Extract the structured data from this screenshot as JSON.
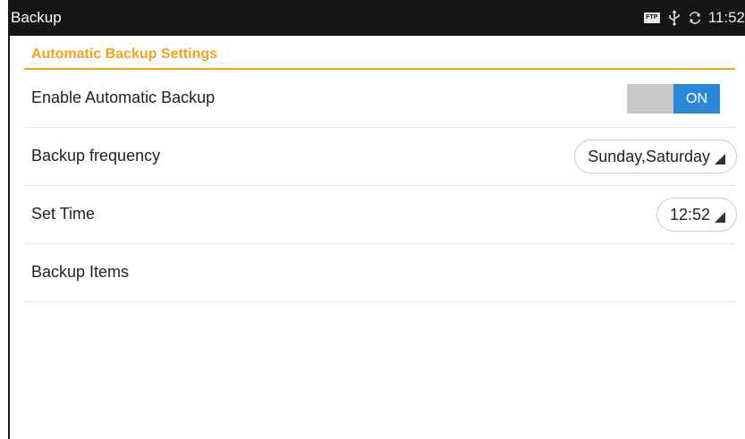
{
  "window": {
    "title": "Backup"
  },
  "status": {
    "ftp": "FTP",
    "time": "11:52",
    "icons": [
      "ftp-icon",
      "usb-icon",
      "sync-icon"
    ]
  },
  "section": {
    "title": "Automatic Backup Settings"
  },
  "rows": {
    "auto_backup": {
      "label": "Enable Automatic Backup",
      "toggle": "ON"
    },
    "frequency": {
      "label": "Backup frequency",
      "value": "Sunday,Saturday"
    },
    "time": {
      "label": "Set Time",
      "value": "12:52"
    },
    "items": {
      "label": "Backup Items"
    }
  },
  "colors": {
    "accent": "#f2a31b",
    "toggle_on": "#2b88d8",
    "titlebar": "#161616"
  }
}
